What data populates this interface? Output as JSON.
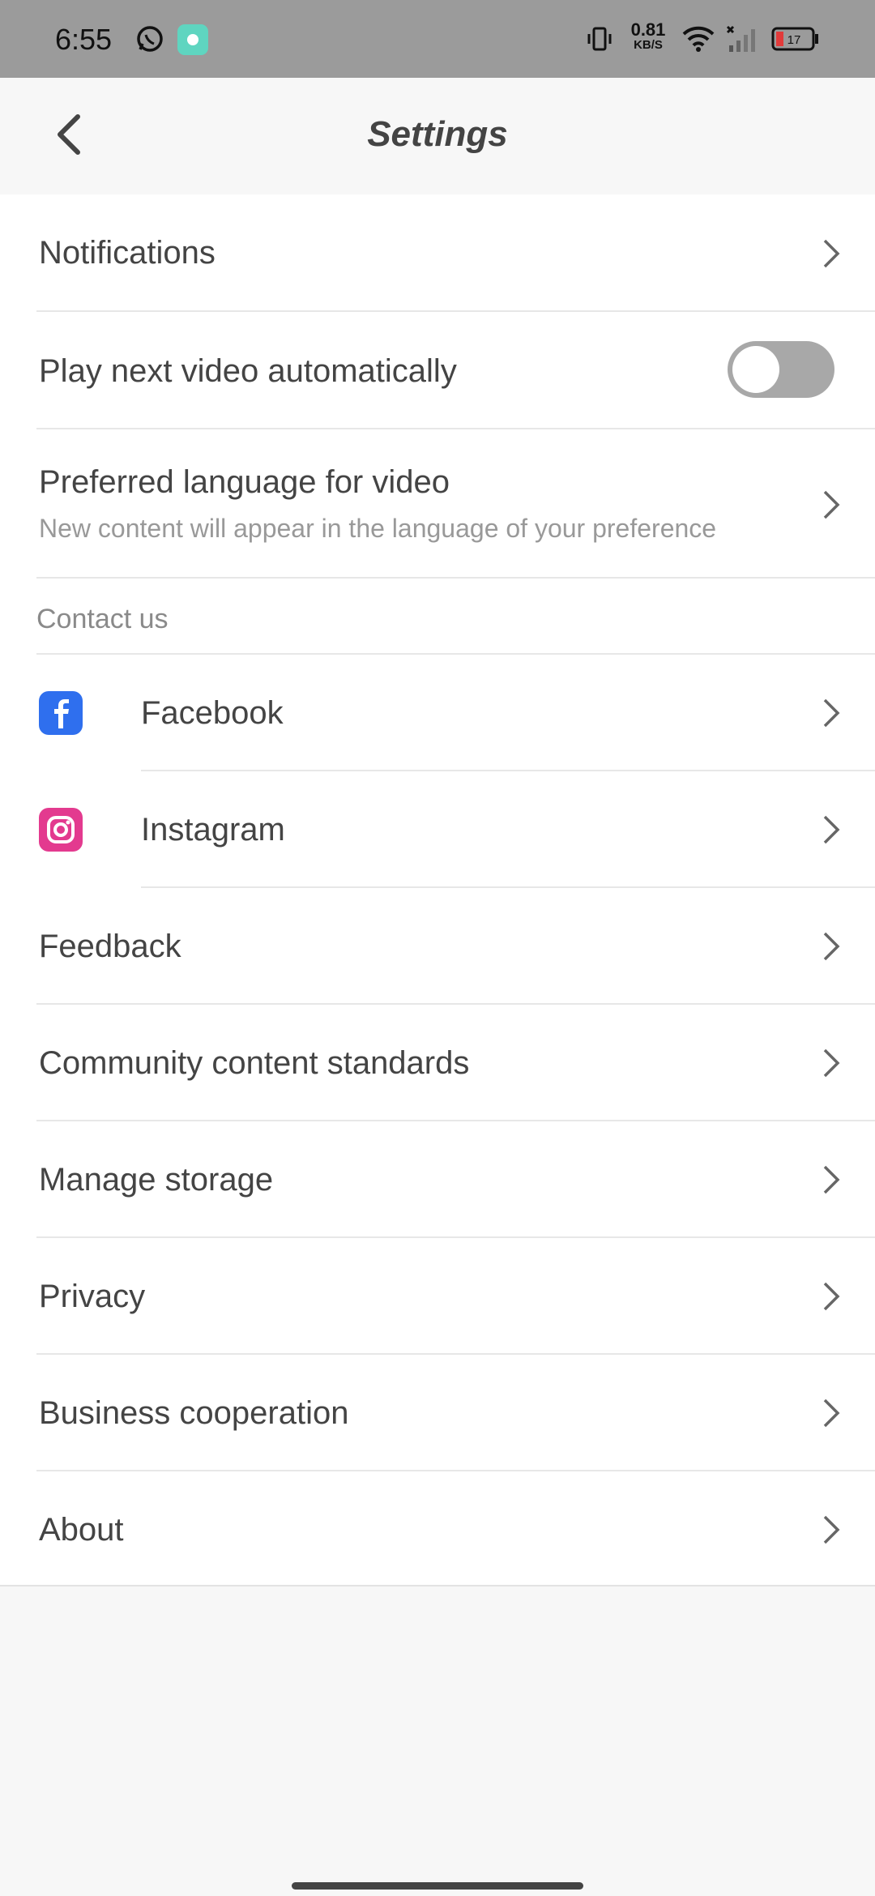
{
  "status_bar": {
    "time": "6:55",
    "net_speed_value": "0.81",
    "net_speed_unit": "KB/S",
    "battery": "17",
    "icons": [
      "whatsapp-icon",
      "app-notification-icon",
      "vibrate-icon",
      "wifi-icon",
      "signal-icon",
      "battery-icon"
    ]
  },
  "header": {
    "title": "Settings"
  },
  "settings": {
    "notifications": "Notifications",
    "autoplay": "Play next video automatically",
    "autoplay_on": false,
    "language_title": "Preferred language for video",
    "language_sub": "New content will appear in the language of your preference",
    "contact_us": "Contact us",
    "facebook": "Facebook",
    "instagram": "Instagram",
    "feedback": "Feedback",
    "community": "Community content standards",
    "storage": "Manage storage",
    "privacy": "Privacy",
    "business": "Business cooperation",
    "about": "About"
  },
  "colors": {
    "facebook": "#2f6fee",
    "instagram": "#e33a8f",
    "toggle_off": "#a8a8a8"
  }
}
